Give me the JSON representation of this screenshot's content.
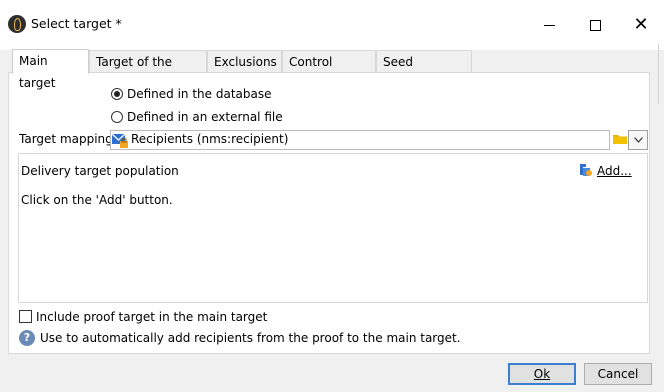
{
  "window": {
    "title": "Select target *"
  },
  "tabs": [
    {
      "label": "Main target"
    },
    {
      "label": "Target of the proofs"
    },
    {
      "label": "Exclusions"
    },
    {
      "label": "Control group"
    },
    {
      "label": "Seed addresses"
    }
  ],
  "main": {
    "radio_database": "Defined in the database",
    "radio_external": "Defined in an external file",
    "radio_selected": "database",
    "mapping_label": "Target mapping:",
    "mapping_value": "Recipients (nms:recipient)",
    "population_label": "Delivery target population",
    "add_label": "Add...",
    "empty_hint": "Click on the 'Add' button.",
    "include_proof_label": "Include proof target in the main target",
    "include_proof_checked": false,
    "help_text": "Use to automatically add recipients from the proof to the main target."
  },
  "buttons": {
    "ok": "Ok",
    "cancel": "Cancel"
  },
  "colors": {
    "default_button_border": "#3c7fd1",
    "help_icon": "#6c8ab7",
    "folder": "#e8b500"
  }
}
